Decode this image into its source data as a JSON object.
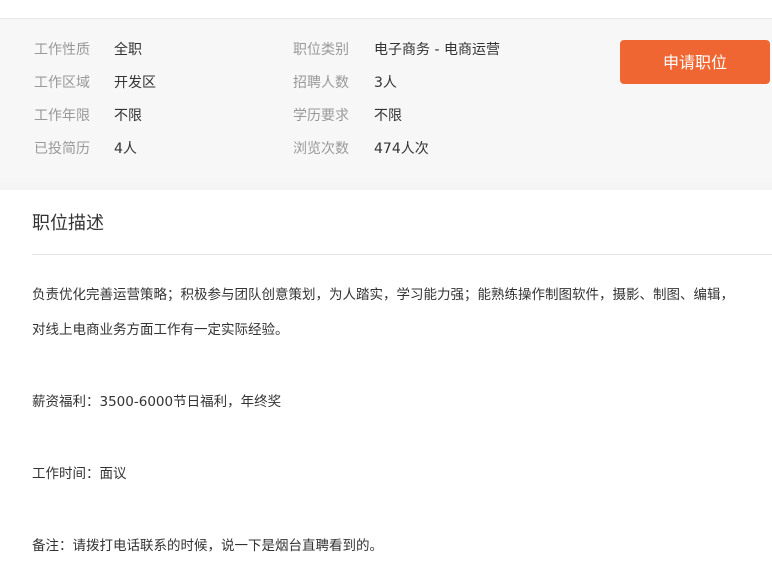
{
  "info": {
    "rows": [
      {
        "label1": "工作性质",
        "value1": "全职",
        "label2": "职位类别",
        "value2": "电子商务 - 电商运营"
      },
      {
        "label1": "工作区域",
        "value1": "开发区",
        "label2": "招聘人数",
        "value2": "3人"
      },
      {
        "label1": "工作年限",
        "value1": "不限",
        "label2": "学历要求",
        "value2": "不限"
      },
      {
        "label1": "已投简历",
        "value1": "4人",
        "label2": "浏览次数",
        "value2": "474人次"
      }
    ],
    "apply_label": "申请职位",
    "accent_color": "#f06632"
  },
  "description": {
    "title": "职位描述",
    "lines": [
      "负责优化完善运营策略；积极参与团队创意策划，为人踏实，学习能力强；能熟练操作制图软件，摄影、制图、编辑，",
      "对线上电商业务方面工作有一定实际经验。",
      "薪资福利：3500-6000节日福利，年终奖",
      "工作时间：面议",
      "备注：请拨打电话联系的时候，说一下是烟台直聘看到的。"
    ]
  }
}
